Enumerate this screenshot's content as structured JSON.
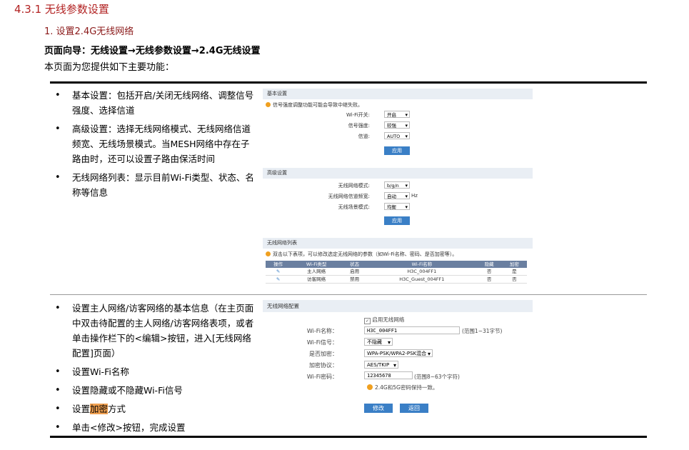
{
  "section_title": "4.3.1  无线参数设置",
  "subsection_title": "1. 设置2.4G无线网络",
  "nav_path": "页面向导：无线设置→无线参数设置→2.4G无线设置",
  "intro": "本页面为您提供如下主要功能：",
  "block1": {
    "bullets": [
      "基本设置：包括开启/关闭无线网络、调整信号强度、选择信道",
      "高级设置：选择无线网络模式、无线网络信道频宽、无线场景模式。当MESH网络中存在子路由时，还可以设置子路由保活时间",
      "无线网络列表：显示目前Wi-Fi类型、状态、名称等信息"
    ],
    "basic": {
      "header": "基本设置",
      "notice": "信号强度调整功能可能会导致中继失败。",
      "wifi_switch_label": "Wi-Fi开关:",
      "wifi_switch_value": "开启",
      "signal_label": "信号强度:",
      "signal_value": "较强",
      "channel_label": "信道:",
      "channel_value": "AUTO",
      "apply": "应用"
    },
    "advanced": {
      "header": "高级设置",
      "mode_label": "无线网络模式:",
      "mode_value": "b/g/n",
      "bandwidth_label": "无线网络信道频宽:",
      "bandwidth_value": "自动",
      "bandwidth_unit": "Hz",
      "scene_label": "无线场景模式:",
      "scene_value": "均衡",
      "apply": "应用"
    },
    "list": {
      "header": "无线网络列表",
      "notice": "双击以下表项，可以修改选定无线网络的参数（如Wi-Fi名称、密码、是否加密等）。",
      "columns": [
        "操作",
        "Wi-Fi类型",
        "状态",
        "Wi-Fi名称",
        "隐藏",
        "加密"
      ],
      "rows": [
        [
          "",
          "主人网络",
          "启用",
          "H3C_004FF1",
          "否",
          "是"
        ],
        [
          "",
          "访客网络",
          "禁用",
          "H3C_Guest_004FF1",
          "否",
          "否"
        ]
      ]
    }
  },
  "block2": {
    "bullets": [
      "设置主人网络/访客网络的基本信息（在主页面中双击待配置的主人网络/访客网络表项，或者单击操作栏下的<编辑>按钮，进入[无线网络配置]页面）",
      "设置Wi-Fi名称",
      "设置隐藏或不隐藏Wi-Fi信号",
      "单击<修改>按钮，完成设置"
    ],
    "bullet_enc_prefix": "设置",
    "bullet_enc_highlight": "加密",
    "bullet_enc_suffix": "方式",
    "config": {
      "header": "无线网络配置",
      "enable_label": "启用无线网络",
      "name_label": "Wi-Fi名称：",
      "name_value": "H3C_004FF1",
      "name_hint": "(范围1~31字节)",
      "signal_label": "Wi-Fi信号：",
      "signal_value": "不隐藏",
      "encrypt_label": "是否加密：",
      "encrypt_value": "WPA-PSK/WPA2-PSK混合",
      "protocol_label": "加密协议：",
      "protocol_value": "AES/TKIP",
      "password_label": "Wi-Fi密码：",
      "password_value": "12345678",
      "password_hint": "(范围8~63个字符)",
      "sync_notice": "2.4G和5G密码保持一致。",
      "modify": "修改",
      "back": "返回"
    }
  }
}
